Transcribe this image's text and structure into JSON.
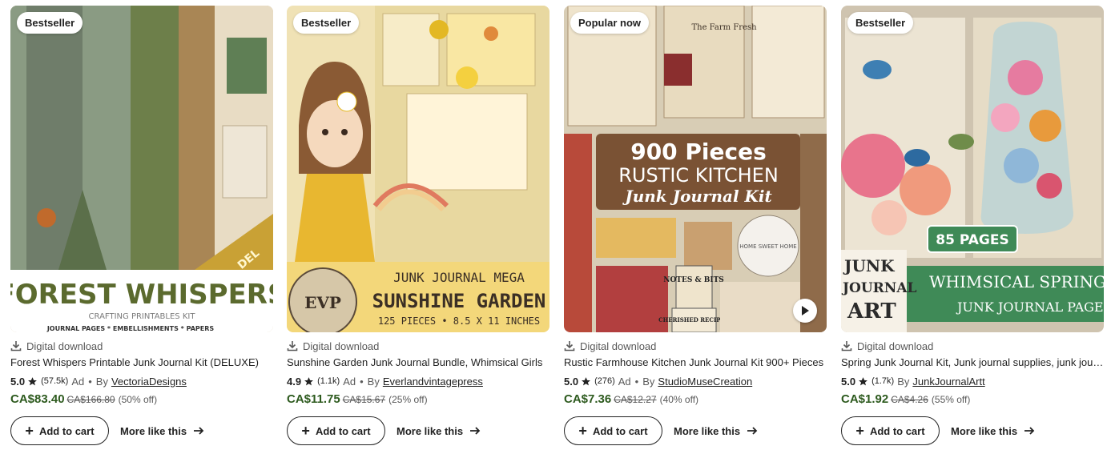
{
  "listings": [
    {
      "badge": "Bestseller",
      "download_label": "Digital download",
      "title": "Forest Whispers Printable Junk Journal Kit (DELUXE)",
      "rating": "5.0",
      "reviews": "(57.5k)",
      "ad": "Ad",
      "by": "By",
      "shop": "VectoriaDesigns",
      "price": "CA$83.40",
      "original_price": "CA$166.80",
      "discount": "(50% off)",
      "add_to_cart": "Add to cart",
      "more_like_this": "More like this",
      "image_text": {
        "line1": "FOREST WHISPERS",
        "line2": "CRAFTING PRINTABLES KIT",
        "line3": "JOURNAL PAGES * EMBELLISHMENTS * PAPERS",
        "ribbon": "DEL"
      }
    },
    {
      "badge": "Bestseller",
      "download_label": "Digital download",
      "title": "Sunshine Garden Junk Journal Bundle, Whimsical Girls",
      "rating": "4.9",
      "reviews": "(1.1k)",
      "ad": "Ad",
      "by": "By",
      "shop": "Everlandvintagepress",
      "price": "CA$11.75",
      "original_price": "CA$15.67",
      "discount": "(25% off)",
      "add_to_cart": "Add to cart",
      "more_like_this": "More like this",
      "image_text": {
        "line1": "JUNK JOURNAL MEGA",
        "line2": "SUNSHINE GARDEN",
        "line3": "125 PIECES • 8.5 X 11 INCHES",
        "seal": "EVP"
      }
    },
    {
      "badge": "Popular now",
      "download_label": "Digital download",
      "title": "Rustic Farmhouse Kitchen Junk Journal Kit 900+ Pieces",
      "rating": "5.0",
      "reviews": "(276)",
      "ad": "Ad",
      "by": "By",
      "shop": "StudioMuseCreation",
      "price": "CA$7.36",
      "original_price": "CA$12.27",
      "discount": "(40% off)",
      "add_to_cart": "Add to cart",
      "more_like_this": "More like this",
      "image_text": {
        "line1": "900 Pieces",
        "line2": "RUSTIC KITCHEN",
        "line3": "Junk Journal Kit",
        "tag1": "The Farm Fresh",
        "tag2": "NOTES & BITS",
        "tag3": "CHERISHED RECIPES",
        "tag4": "HOME SWEET HOME"
      }
    },
    {
      "badge": "Bestseller",
      "download_label": "Digital download",
      "title": "Spring Junk Journal Kit, Junk journal supplies, junk journal pages",
      "rating": "5.0",
      "reviews": "(1.7k)",
      "ad": "",
      "by": "By",
      "shop": "JunkJournalArtt",
      "price": "CA$1.92",
      "original_price": "CA$4.26",
      "discount": "(55% off)",
      "add_to_cart": "Add to cart",
      "more_like_this": "More like this",
      "image_text": {
        "line1": "85 PAGES",
        "line2": "WHIMSICAL SPRING",
        "line3": "JUNK JOURNAL PAGES",
        "logo1": "JUNK",
        "logo2": "JOURNAL",
        "logo3": "ART"
      }
    }
  ],
  "colors": {
    "price": "#2d5a1e",
    "text": "#222222",
    "muted": "#595959"
  }
}
